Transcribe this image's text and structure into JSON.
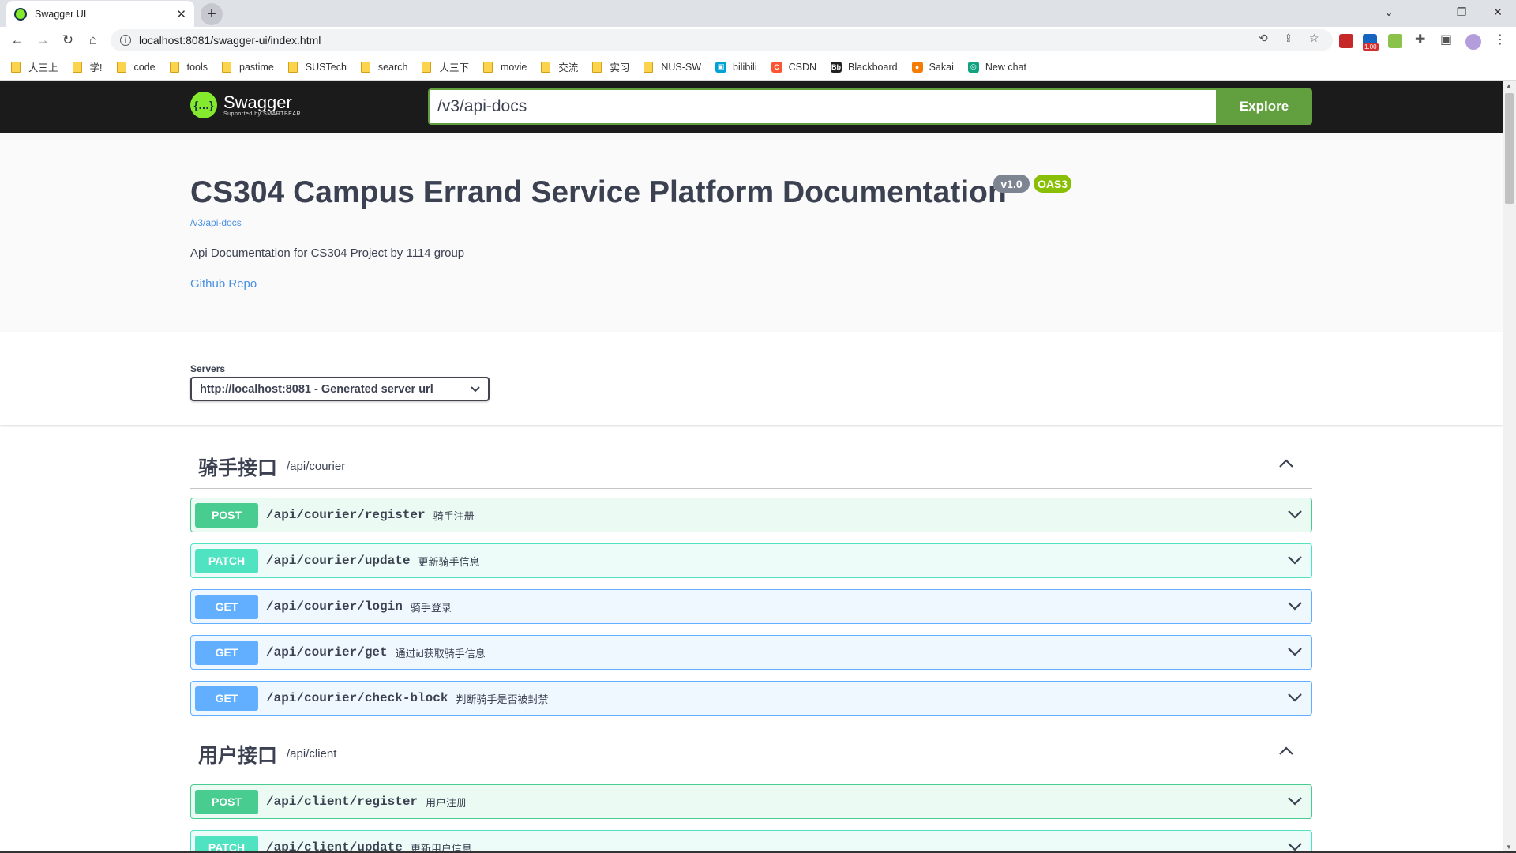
{
  "browser": {
    "tab_title": "Swagger UI",
    "tab_close": "✕",
    "new_tab": "+",
    "url": "localhost:8081/swagger-ui/index.html",
    "bookmarks": [
      {
        "label": "大三上",
        "icon": "folder"
      },
      {
        "label": "学!",
        "icon": "folder"
      },
      {
        "label": "code",
        "icon": "folder"
      },
      {
        "label": "tools",
        "icon": "folder"
      },
      {
        "label": "pastime",
        "icon": "folder"
      },
      {
        "label": "SUSTech",
        "icon": "folder"
      },
      {
        "label": "search",
        "icon": "folder"
      },
      {
        "label": "大三下",
        "icon": "folder"
      },
      {
        "label": "movie",
        "icon": "folder"
      },
      {
        "label": "交流",
        "icon": "folder"
      },
      {
        "label": "实习",
        "icon": "folder"
      },
      {
        "label": "NUS-SW",
        "icon": "folder"
      },
      {
        "label": "bilibili",
        "icon": "bilibili"
      },
      {
        "label": "CSDN",
        "icon": "csdn"
      },
      {
        "label": "Blackboard",
        "icon": "blackboard"
      },
      {
        "label": "Sakai",
        "icon": "sakai"
      },
      {
        "label": "New chat",
        "icon": "chatgpt"
      }
    ],
    "ext_badge": "1.00"
  },
  "swagger": {
    "logo_text": "Swagger",
    "logo_sub": "Supported by SMARTBEAR",
    "spec_url": "/v3/api-docs",
    "explore_label": "Explore"
  },
  "info": {
    "title": "CS304 Campus Errand Service Platform Documentation",
    "version": "v1.0",
    "oas": "OAS3",
    "spec_link": "/v3/api-docs",
    "description": "Api Documentation for CS304 Project by 1114 group",
    "repo_link": "Github Repo"
  },
  "servers": {
    "label": "Servers",
    "selected": "http://localhost:8081 - Generated server url"
  },
  "tags": [
    {
      "name": "骑手接口",
      "path": "/api/courier",
      "operations": [
        {
          "method": "POST",
          "path": "/api/courier/register",
          "summary": "骑手注册"
        },
        {
          "method": "PATCH",
          "path": "/api/courier/update",
          "summary": "更新骑手信息"
        },
        {
          "method": "GET",
          "path": "/api/courier/login",
          "summary": "骑手登录"
        },
        {
          "method": "GET",
          "path": "/api/courier/get",
          "summary": "通过id获取骑手信息"
        },
        {
          "method": "GET",
          "path": "/api/courier/check-block",
          "summary": "判断骑手是否被封禁"
        }
      ]
    },
    {
      "name": "用户接口",
      "path": "/api/client",
      "operations": [
        {
          "method": "POST",
          "path": "/api/client/register",
          "summary": "用户注册"
        },
        {
          "method": "PATCH",
          "path": "/api/client/update",
          "summary": "更新用户信息"
        }
      ]
    }
  ],
  "colors": {
    "post": "#49cc90",
    "patch": "#50e3c2",
    "get": "#61affe",
    "explore": "#62a03f",
    "topbar": "#1b1b1b"
  }
}
